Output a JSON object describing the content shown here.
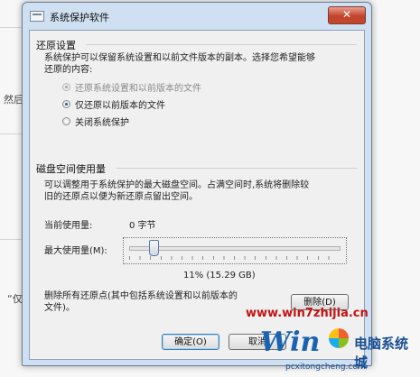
{
  "background": {
    "fragments": [
      "然后",
      "“仅"
    ]
  },
  "window": {
    "title": "系统保护软件",
    "close_glyph": "✕"
  },
  "restore_settings": {
    "group_title": "还原设置",
    "description_line1": "系统保护可以保留系统设置和以前文件版本的副本。选择您希望能够",
    "description_line2": "还原的内容:",
    "options": [
      {
        "label": "还原系统设置和以前版本的文件",
        "selected": true,
        "enabled": false
      },
      {
        "label": "仅还原以前版本的文件",
        "selected": true,
        "enabled": true
      },
      {
        "label": "关闭系统保护",
        "selected": false,
        "enabled": true
      }
    ]
  },
  "disk_usage": {
    "group_title": "磁盘空间使用量",
    "description_line1": "可以调整用于系统保护的最大磁盘空间。占满空间时,系统将删除较",
    "description_line2": "旧的还原点以便为新还原点留出空间。",
    "current_label": "当前使用量:",
    "current_value": "0 字节",
    "max_label": "最大使用量(M):",
    "slider_fraction": 0.11,
    "slider_readout": "11% (15.29 GB)",
    "delete_text_line1": "删除所有还原点(其中包括系统设置和以前版本的",
    "delete_text_line2": "文件)。",
    "delete_button": "删除(D)"
  },
  "footer": {
    "ok_button": "确定(O)",
    "cancel_button": "取消"
  },
  "watermark": {
    "url": "www.win7zhijia.cn",
    "logo_word": "Win",
    "logo_chinese": "电脑系统城",
    "logo_domain": "pcxitongcheng.com"
  }
}
